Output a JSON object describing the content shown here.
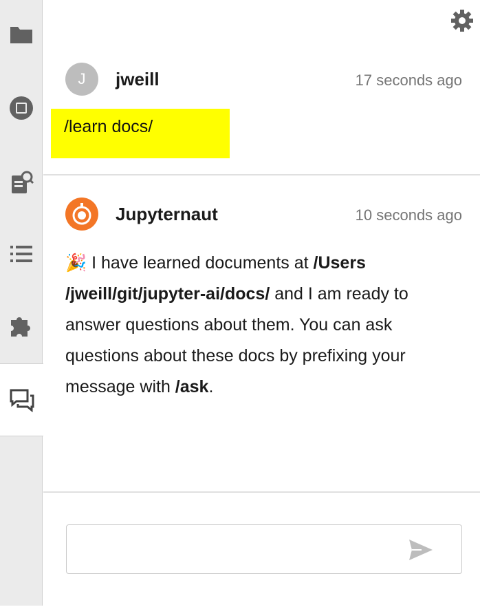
{
  "sidebar": {
    "tabs": [
      {
        "icon": "folder-icon"
      },
      {
        "icon": "stop-circle-icon"
      },
      {
        "icon": "property-inspector-icon"
      },
      {
        "icon": "list-icon"
      },
      {
        "icon": "extension-puzzle-icon"
      },
      {
        "icon": "chat-icon",
        "active": true
      }
    ]
  },
  "settings": {
    "icon": "gear-icon"
  },
  "messages": [
    {
      "avatar_letter": "J",
      "author": "jweill",
      "timestamp": "17 seconds ago",
      "body": "/learn docs/",
      "highlight_color": "#ffff00"
    },
    {
      "author": "Jupyternaut",
      "timestamp": "10 seconds ago",
      "emoji": "🎉",
      "body_parts": [
        " I have learned documents at ",
        "/Users /jweill/git/jupyter-ai/docs/",
        " and I am ready to answer questions about them. You can ask questions about these docs by prefixing your message with ",
        "/ask",
        "."
      ],
      "avatar_color": "#f37626"
    }
  ],
  "input": {
    "value": "",
    "placeholder": "",
    "send_icon": "send-icon"
  }
}
